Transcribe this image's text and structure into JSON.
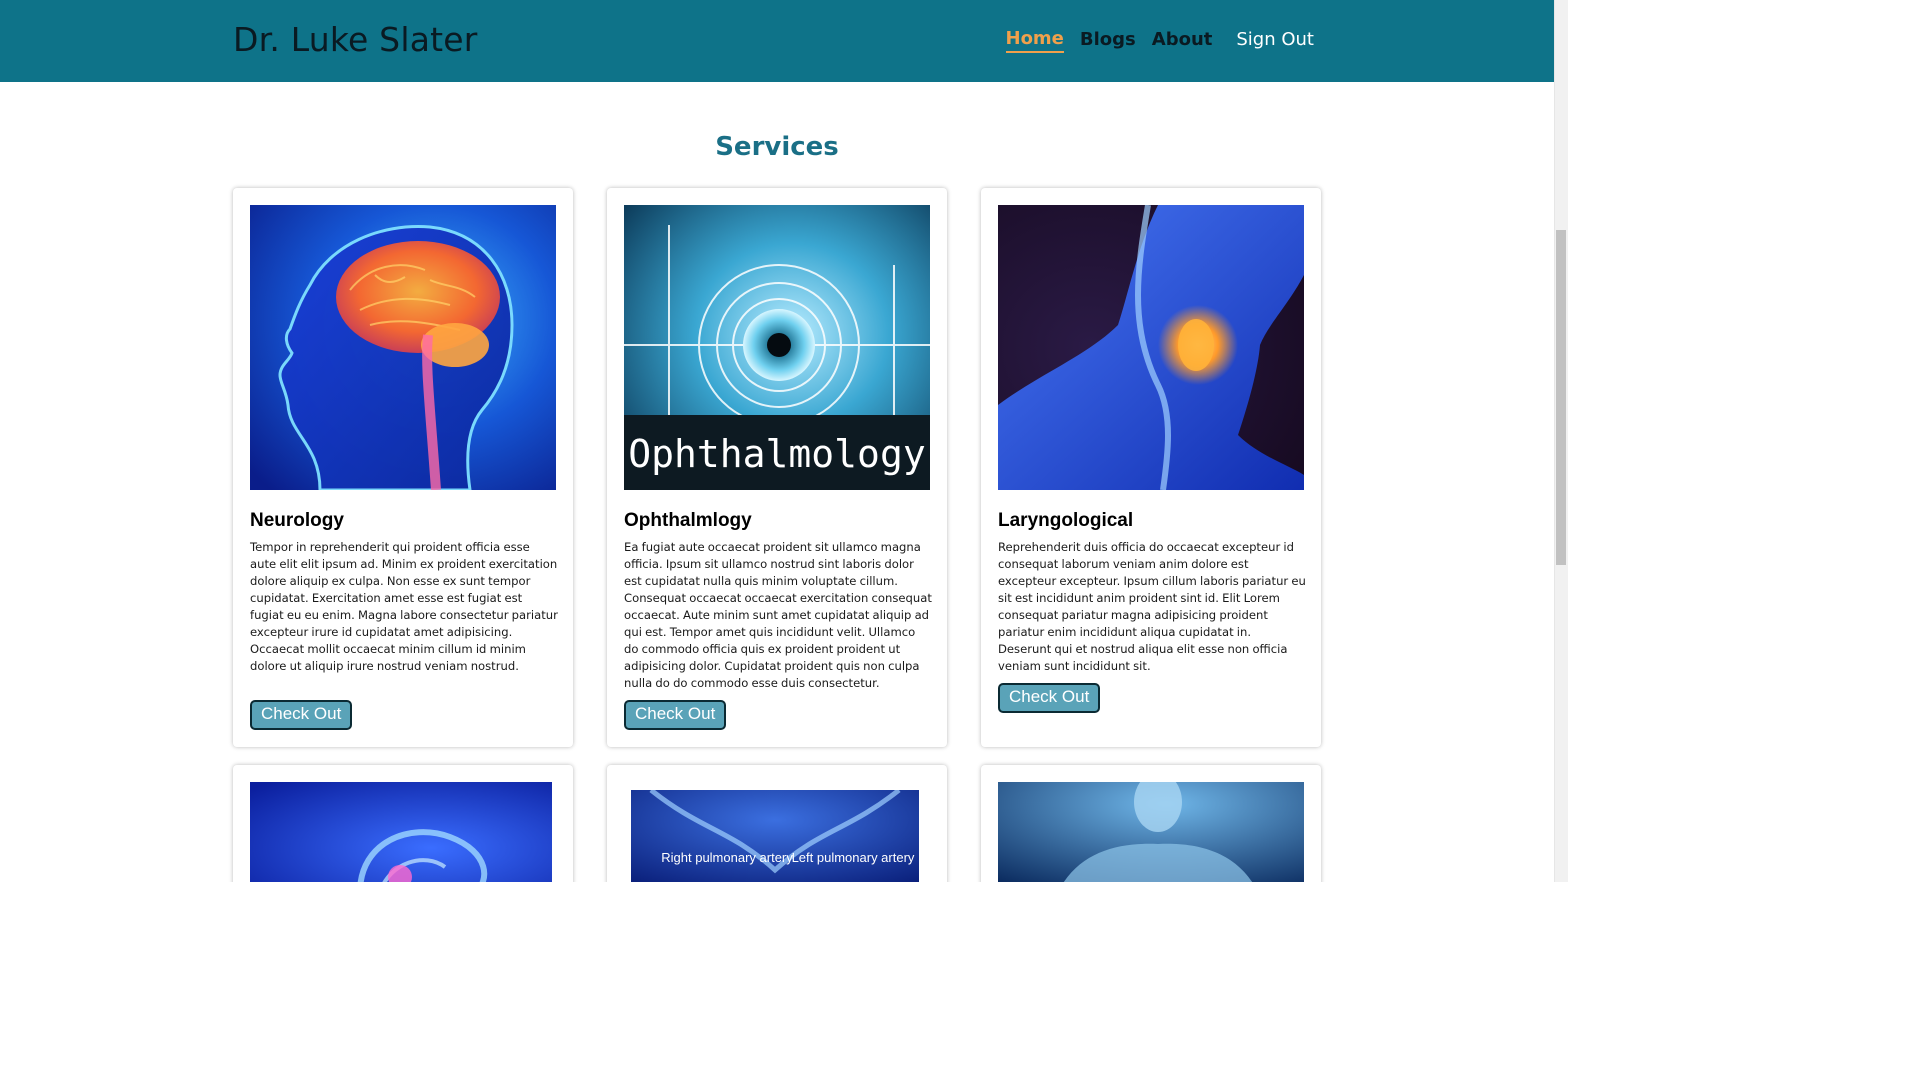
{
  "header": {
    "brand": "Dr. Luke Slater",
    "nav": [
      {
        "label": "Home",
        "active": true
      },
      {
        "label": "Blogs",
        "active": false
      },
      {
        "label": "About",
        "active": false
      }
    ],
    "sign_out": "Sign Out"
  },
  "main": {
    "title": "Services",
    "cards": [
      {
        "title": "Neurology",
        "text": "Tempor in reprehenderit qui proident officia esse aute elit elit ipsum ad. Minim ex proident exercitation dolore aliquip ex culpa. Non esse ex sunt tempor cupidatat. Exercitation amet esse est fugiat est fugiat eu eu enim. Magna labore consectetur pariatur excepteur irure id cupidatat amet adipisicing. Occaecat mollit occaecat minim cillum id minim dolore ut aliquip irure nostrud veniam nostrud.",
        "button": "Check Out"
      },
      {
        "title": "Ophthalmlogy",
        "image_text": "Ophthalmology",
        "text": "Ea fugiat aute occaecat proident sit ullamco magna officia. Ipsum sit ullamco nostrud sint laboris dolor est cupidatat nulla quis minim voluptate cillum. Consequat occaecat occaecat exercitation consequat occaecat. Aute minim sunt amet cupidatat aliquip ad qui est. Tempor amet quis incididunt velit. Ullamco do commodo officia quis ex proident proident ut adipisicing dolor. Cupidatat proident quis non culpa nulla do do commodo esse duis consectetur.",
        "button": "Check Out"
      },
      {
        "title": "Laryngological",
        "text": "Reprehenderit duis officia do occaecat excepteur id consequat laborum veniam anim dolore est excepteur excepteur. Ipsum cillum laboris pariatur eu sit est incididunt anim proident sint id. Elit Lorem consequat pariatur magna adipisicing proident pariatur enim incididunt aliqua cupidatat in. Deserunt qui et nostrud aliqua elit esse non officia veniam sunt incididunt sit.",
        "button": "Check Out"
      }
    ],
    "partial_cards": [
      {
        "image_labels": []
      },
      {
        "image_labels": [
          "Right pulmonary artery",
          "Left pulmonary artery"
        ]
      },
      {
        "image_labels": []
      }
    ]
  },
  "colors": {
    "header_bg": "#0e7389",
    "accent": "#f0a04b",
    "title": "#1a6f86",
    "button_bg": "#5aa3b8"
  }
}
